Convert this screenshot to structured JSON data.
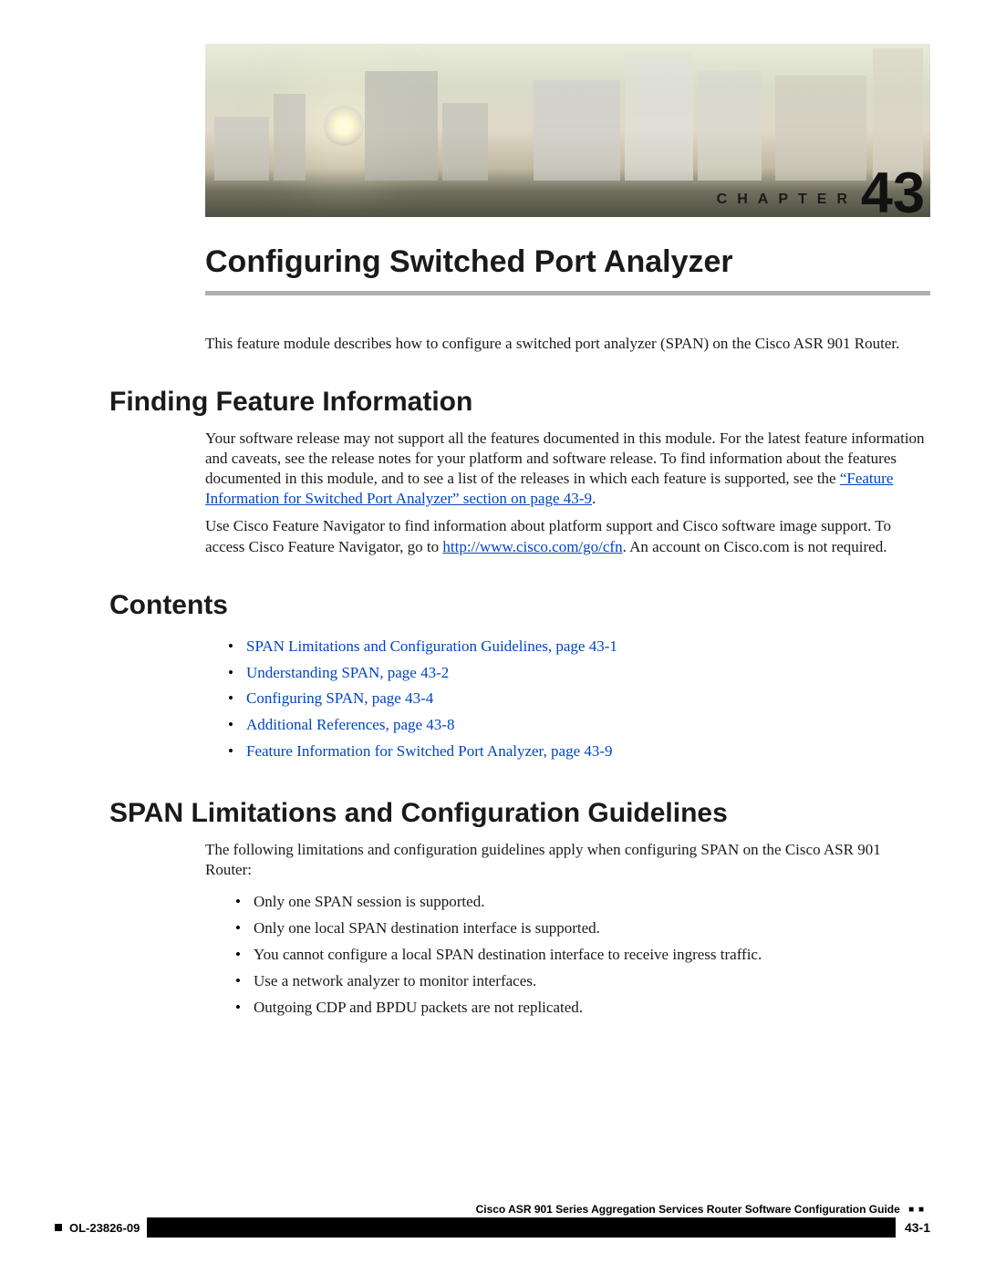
{
  "chapter": {
    "label": "CHAPTER",
    "number": "43"
  },
  "title": "Configuring Switched Port Analyzer",
  "intro": "This feature module describes how to configure a switched port analyzer (SPAN) on the Cisco ASR 901 Router.",
  "sections": {
    "finding": {
      "heading": "Finding Feature Information",
      "para1_pre": "Your software release may not support all the features documented in this module. For the latest feature information and caveats, see the release notes for your platform and software release. To find information about the features documented in this module, and to see a list of the releases in which each feature is supported, see the ",
      "para1_link": "“Feature Information for Switched Port Analyzer” section on page 43-9",
      "para1_post": ".",
      "para2_pre": "Use Cisco Feature Navigator to find information about platform support and Cisco software image support. To access Cisco Feature Navigator, go to ",
      "para2_link": "http://www.cisco.com/go/cfn",
      "para2_post": ". An account on Cisco.com is not required."
    },
    "contents": {
      "heading": "Contents",
      "items": [
        "SPAN Limitations and Configuration Guidelines, page 43-1",
        "Understanding SPAN, page 43-2",
        "Configuring SPAN, page 43-4",
        "Additional References, page 43-8",
        "Feature Information for Switched Port Analyzer, page 43-9"
      ]
    },
    "limits": {
      "heading": "SPAN Limitations and Configuration Guidelines",
      "intro": "The following limitations and configuration guidelines apply when configuring SPAN on the Cisco ASR 901 Router:",
      "items": [
        "Only one SPAN session is supported.",
        "Only one local SPAN destination interface is supported.",
        "You cannot configure a local SPAN destination interface to receive ingress traffic.",
        "Use a network analyzer to monitor interfaces.",
        "Outgoing CDP and BPDU packets are not replicated."
      ]
    }
  },
  "footer": {
    "guide": "Cisco ASR 901 Series Aggregation Services Router Software Configuration Guide",
    "doc_id": "OL-23826-09",
    "page": "43-1"
  }
}
